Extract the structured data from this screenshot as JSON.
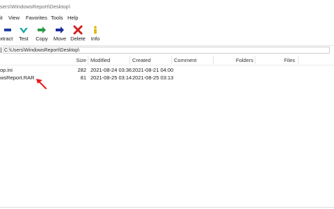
{
  "window": {
    "title": "sers\\WindowsReport\\Desktop\\"
  },
  "menu": [
    "it",
    "View",
    "Favorites",
    "Tools",
    "Help"
  ],
  "toolbar": [
    {
      "label": "xtract",
      "icon": "extract-icon",
      "color": "#1f3fa8"
    },
    {
      "label": "Test",
      "icon": "test-icon",
      "color": "#18a8a8"
    },
    {
      "label": "Copy",
      "icon": "copy-icon",
      "color": "#2e9a4a"
    },
    {
      "label": "Move",
      "icon": "move-icon",
      "color": "#1f2f9a"
    },
    {
      "label": "Delete",
      "icon": "delete-icon",
      "color": "#d21f1f"
    },
    {
      "label": "Info",
      "icon": "info-icon",
      "color": "#e0b400"
    }
  ],
  "address": {
    "path": "C:\\Users\\WindowsReport\\Desktop\\"
  },
  "columns": [
    "Size",
    "Modified",
    "Created",
    "Comment",
    "Folders",
    "Files"
  ],
  "files": [
    {
      "name": "op.ini",
      "size": "282",
      "modified": "2021-08-24 03:36",
      "created": "2021-08-21 04:00"
    },
    {
      "name": "wsReport.RAR",
      "size": "81",
      "modified": "2021-08-25 03:14",
      "created": "2021-08-25 03:13"
    }
  ],
  "annotation": {
    "arrow_color": "#e81b1b",
    "icon": "red-arrow-icon"
  }
}
